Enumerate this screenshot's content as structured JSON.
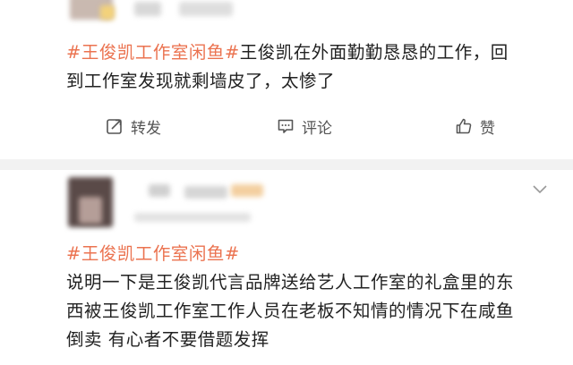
{
  "post1": {
    "tag": "#王俊凯工作室闲鱼#",
    "text_line1_rest": "王俊凯在外面勤勤恳恳的工作，回",
    "text_line2": "到工作室发现就剩墙皮了，太惨了"
  },
  "actions": {
    "repost_label": "转发",
    "comment_label": "评论",
    "like_label": "赞"
  },
  "post2": {
    "tag": "#王俊凯工作室闲鱼#",
    "line1": "说明一下是王俊凯代言品牌送给艺人工作室的礼盒里的东",
    "line2": "西被王俊凯工作室工作人员在老板不知情的情况下在咸鱼",
    "line3": "倒卖 有心者不要借题发挥"
  },
  "colors": {
    "tag": "#eb7350",
    "text": "#222222",
    "action_text": "#555555",
    "page_bg": "#f2f2f2"
  }
}
